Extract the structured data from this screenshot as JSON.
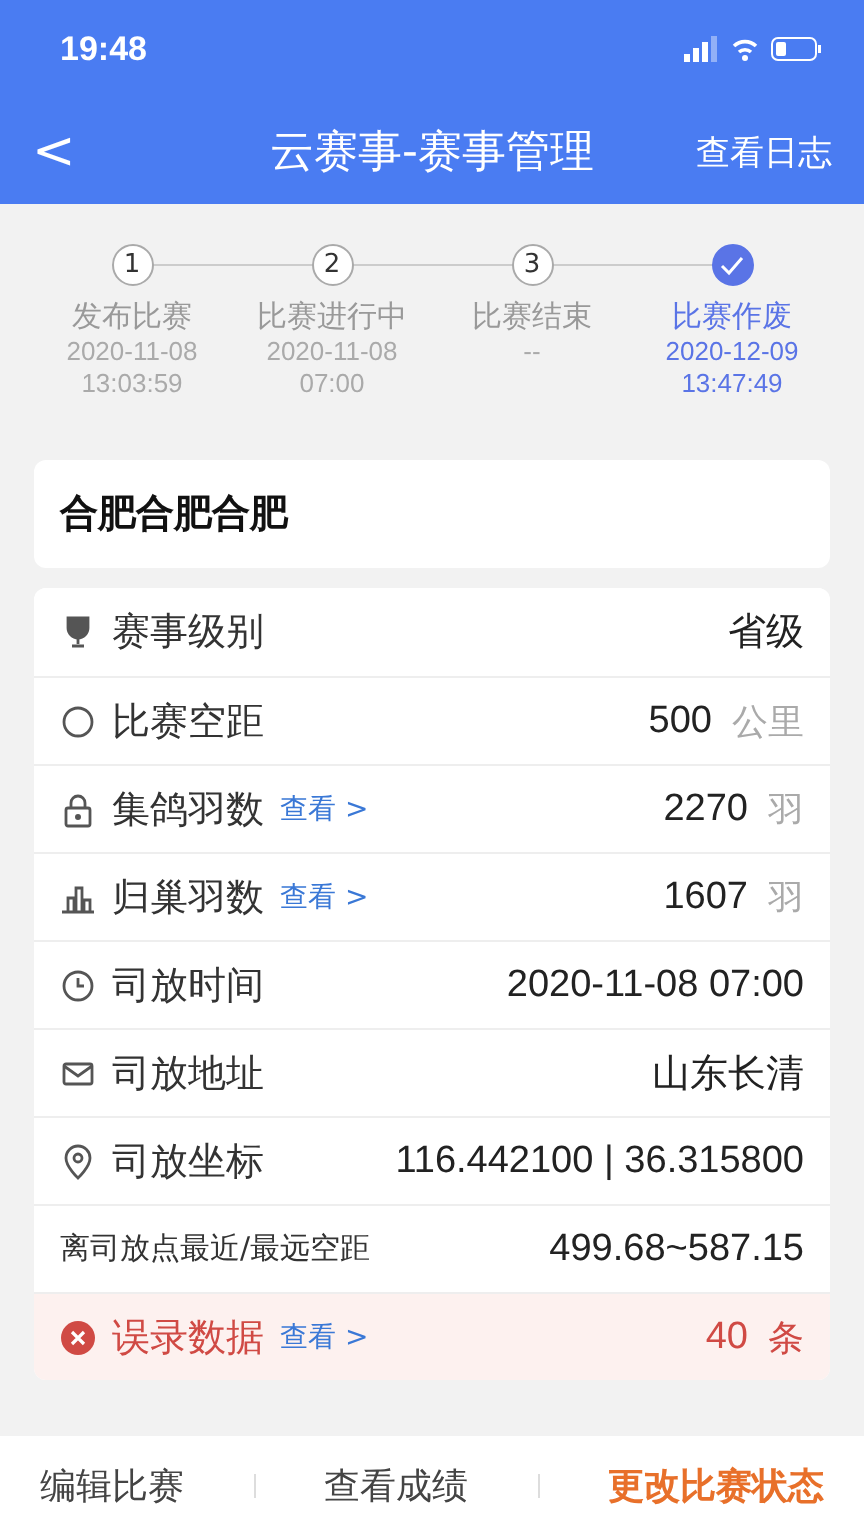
{
  "status_bar": {
    "time": "19:48"
  },
  "nav": {
    "back": "<",
    "title": "云赛事-赛事管理",
    "action": "查看日志"
  },
  "steps": [
    {
      "marker": "1",
      "label": "发布比赛",
      "date": "2020-11-08",
      "time": "13:03:59",
      "selected": false
    },
    {
      "marker": "2",
      "label": "比赛进行中",
      "date": "2020-11-08",
      "time": "07:00",
      "selected": false
    },
    {
      "marker": "3",
      "label": "比赛结束",
      "date": "--",
      "selected": false
    },
    {
      "label": "比赛作废",
      "date": "2020-12-09",
      "time": "13:47:49",
      "selected": true
    }
  ],
  "race_name": "合肥合肥合肥",
  "rows": [
    {
      "kind": "trophy",
      "label": "赛事级别",
      "value": "省级"
    },
    {
      "kind": "circle",
      "label": "比赛空距",
      "value": "500",
      "unit": "公里"
    },
    {
      "kind": "lock",
      "label": "集鸽羽数",
      "link": "查看 >",
      "value": "2270",
      "unit": "羽"
    },
    {
      "kind": "chart",
      "label": "归巢羽数",
      "link": "查看 >",
      "value": "1607",
      "unit": "羽"
    },
    {
      "kind": "clock",
      "label": "司放时间",
      "value": "2020-11-08 07:00"
    },
    {
      "kind": "mail",
      "label": "司放地址",
      "value": "山东长清"
    },
    {
      "kind": "pin",
      "label": "司放坐标",
      "value": "116.442100 | 36.315800"
    },
    {
      "kind": "plain",
      "label": "离司放点最近/最远空距",
      "value": "499.68~587.15"
    },
    {
      "kind": "error",
      "label": "误录数据",
      "link": "查看 >",
      "value": "40",
      "unit": "条"
    }
  ],
  "actions": [
    {
      "label": "编辑比赛",
      "primary": false
    },
    {
      "label": "查看成绩",
      "primary": false
    },
    {
      "label": "更改比赛状态",
      "primary": true
    }
  ]
}
